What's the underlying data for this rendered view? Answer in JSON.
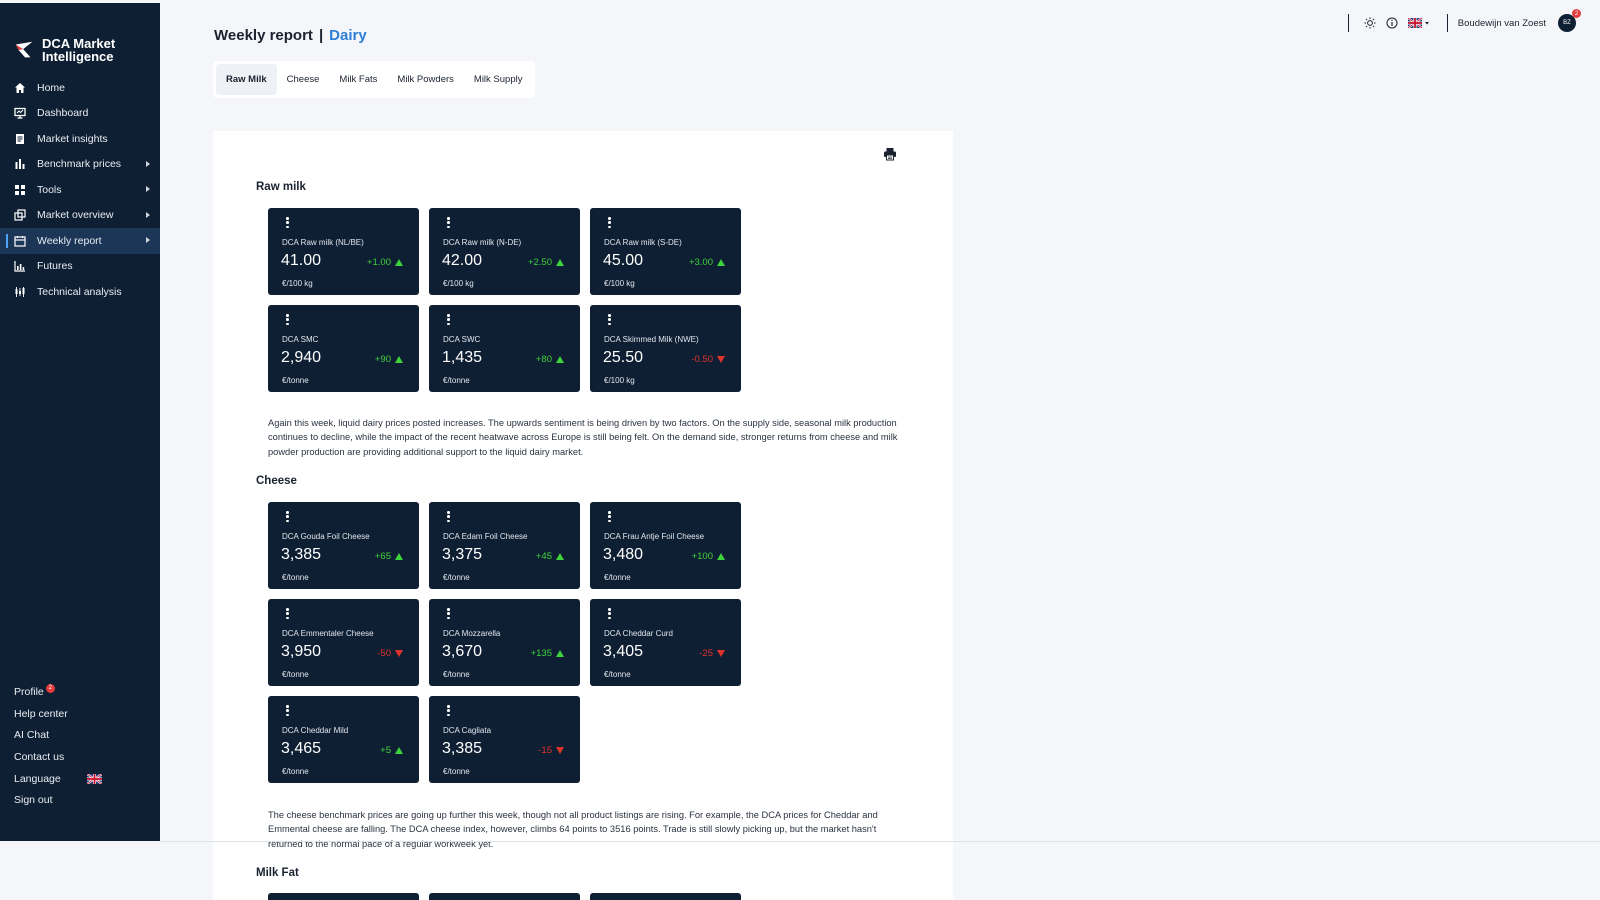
{
  "brand": {
    "name_line1": "DCA Market",
    "name_line2": "Intelligence"
  },
  "sidebar": {
    "items": [
      {
        "label": "Home",
        "icon": "home-icon"
      },
      {
        "label": "Dashboard",
        "icon": "monitor-icon"
      },
      {
        "label": "Market insights",
        "icon": "document-icon"
      },
      {
        "label": "Benchmark prices",
        "icon": "bar-chart-icon",
        "has_submenu": true
      },
      {
        "label": "Tools",
        "icon": "grid-icon",
        "has_submenu": true
      },
      {
        "label": "Market overview",
        "icon": "layers-icon",
        "has_submenu": true
      },
      {
        "label": "Weekly report",
        "icon": "calendar-icon",
        "has_submenu": true,
        "active": true
      },
      {
        "label": "Futures",
        "icon": "chart-icon"
      },
      {
        "label": "Technical analysis",
        "icon": "candlestick-icon"
      }
    ],
    "bottom": {
      "profile": "Profile",
      "profile_badge": "2",
      "help": "Help center",
      "ai_chat": "AI Chat",
      "contact": "Contact us",
      "language": "Language",
      "sign_out": "Sign out"
    }
  },
  "header": {
    "title": "Weekly report",
    "separator": "|",
    "subtitle": "Dairy",
    "user_name": "Boudewijn van Zoest",
    "user_initials": "BZ",
    "notification_count": "2"
  },
  "tabs": [
    {
      "label": "Raw Milk",
      "active": true
    },
    {
      "label": "Cheese"
    },
    {
      "label": "Milk Fats"
    },
    {
      "label": "Milk Powders"
    },
    {
      "label": "Milk Supply"
    }
  ],
  "sections": {
    "raw_milk": {
      "title": "Raw milk",
      "cards": [
        {
          "name": "DCA Raw milk (NL/BE)",
          "value": "41.00",
          "change": "+1.00",
          "direction": "up",
          "unit": "€/100 kg"
        },
        {
          "name": "DCA Raw milk (N-DE)",
          "value": "42.00",
          "change": "+2.50",
          "direction": "up",
          "unit": "€/100 kg"
        },
        {
          "name": "DCA Raw milk (S-DE)",
          "value": "45.00",
          "change": "+3.00",
          "direction": "up",
          "unit": "€/100 kg"
        },
        {
          "name": "DCA SMC",
          "value": "2,940",
          "change": "+90",
          "direction": "up",
          "unit": "€/tonne"
        },
        {
          "name": "DCA SWC",
          "value": "1,435",
          "change": "+80",
          "direction": "up",
          "unit": "€/tonne"
        },
        {
          "name": "DCA Skimmed Milk (NWE)",
          "value": "25.50",
          "change": "-0.50",
          "direction": "down",
          "unit": "€/100 kg"
        }
      ],
      "commentary": "Again this week, liquid dairy prices posted increases. The upwards sentiment is being driven by two factors. On the supply side, seasonal milk production continues to decline, while the impact of the recent heatwave across Europe is still being felt. On the demand side, stronger returns from cheese and milk powder production are providing additional support to the liquid dairy market."
    },
    "cheese": {
      "title": "Cheese",
      "cards": [
        {
          "name": "DCA Gouda Foil Cheese",
          "value": "3,385",
          "change": "+65",
          "direction": "up",
          "unit": "€/tonne"
        },
        {
          "name": "DCA Edam Foil Cheese",
          "value": "3,375",
          "change": "+45",
          "direction": "up",
          "unit": "€/tonne"
        },
        {
          "name": "DCA Frau Antje Foil Cheese",
          "value": "3,480",
          "change": "+100",
          "direction": "up",
          "unit": "€/tonne"
        },
        {
          "name": "DCA Emmentaler Cheese",
          "value": "3,950",
          "change": "-50",
          "direction": "down",
          "unit": "€/tonne"
        },
        {
          "name": "DCA Mozzarella",
          "value": "3,670",
          "change": "+135",
          "direction": "up",
          "unit": "€/tonne"
        },
        {
          "name": "DCA Cheddar Curd",
          "value": "3,405",
          "change": "-25",
          "direction": "down",
          "unit": "€/tonne"
        },
        {
          "name": "DCA Cheddar Mild",
          "value": "3,465",
          "change": "+5",
          "direction": "up",
          "unit": "€/tonne"
        },
        {
          "name": "DCA Cagliata",
          "value": "3,385",
          "change": "-15",
          "direction": "down",
          "unit": "€/tonne"
        }
      ],
      "commentary": "The cheese benchmark prices are going up further this week, though not all product listings are rising. For example, the DCA prices for Cheddar and Emmental cheese are falling. The DCA cheese index, however, climbs 64 points to 3516 points. Trade is still slowly picking up, but the market hasn't returned to the normal pace of a regular workweek yet."
    },
    "milk_fat": {
      "title": "Milk Fat"
    }
  },
  "colors": {
    "sidebar_bg": "#0f1f33",
    "card_bg": "#0f1f33",
    "accent": "#2d7ed8",
    "up": "#3ed23a",
    "down": "#e0332b"
  }
}
